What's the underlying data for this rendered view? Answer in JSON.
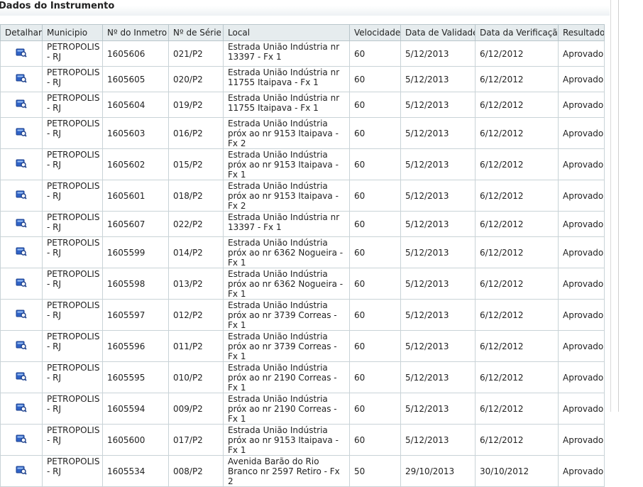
{
  "section": {
    "title": "Dados do Instrumento"
  },
  "table": {
    "headers": [
      "Detalhar",
      "Municipio",
      "Nº do Inmetro",
      "Nº de Série",
      "Local",
      "Velocidade",
      "Data de Validade",
      "Data da Verificação",
      "Resultado"
    ],
    "detail_icon": "detail-magnifier-icon",
    "rows": [
      {
        "municipio": "PETROPOLIS - RJ",
        "inmetro": "1605606",
        "serie": "021/P2",
        "local": "Estrada União Indústria nr 13397 - Fx 1",
        "velocidade": "60",
        "validade": "5/12/2013",
        "verificacao": "6/12/2012",
        "resultado": "Aprovado"
      },
      {
        "municipio": "PETROPOLIS - RJ",
        "inmetro": "1605605",
        "serie": "020/P2",
        "local": "Estrada União Indústria nr 11755 Itaipava - Fx 1",
        "velocidade": "60",
        "validade": "5/12/2013",
        "verificacao": "6/12/2012",
        "resultado": "Aprovado"
      },
      {
        "municipio": "PETROPOLIS - RJ",
        "inmetro": "1605604",
        "serie": "019/P2",
        "local": "Estrada União Indústria nr 11755 Itaipava - Fx 1",
        "velocidade": "60",
        "validade": "5/12/2013",
        "verificacao": "6/12/2012",
        "resultado": "Aprovado"
      },
      {
        "municipio": "PETROPOLIS - RJ",
        "inmetro": "1605603",
        "serie": "016/P2",
        "local": "Estrada União Indústria próx ao nr 9153 Itaipava - Fx 2",
        "velocidade": "60",
        "validade": "5/12/2013",
        "verificacao": "6/12/2012",
        "resultado": "Aprovado"
      },
      {
        "municipio": "PETROPOLIS - RJ",
        "inmetro": "1605602",
        "serie": "015/P2",
        "local": "Estrada União Indústria próx ao nr 9153 Itaipava - Fx 1",
        "velocidade": "60",
        "validade": "5/12/2013",
        "verificacao": "6/12/2012",
        "resultado": "Aprovado"
      },
      {
        "municipio": "PETROPOLIS - RJ",
        "inmetro": "1605601",
        "serie": "018/P2",
        "local": "Estrada União Indústria próx ao nr 9153 Itaipava - Fx 2",
        "velocidade": "60",
        "validade": "5/12/2013",
        "verificacao": "6/12/2012",
        "resultado": "Aprovado"
      },
      {
        "municipio": "PETROPOLIS - RJ",
        "inmetro": "1605607",
        "serie": "022/P2",
        "local": "Estrada União Indústria nr 13397 - Fx 1",
        "velocidade": "60",
        "validade": "5/12/2013",
        "verificacao": "6/12/2012",
        "resultado": "Aprovado"
      },
      {
        "municipio": "PETROPOLIS - RJ",
        "inmetro": "1605599",
        "serie": "014/P2",
        "local": "Estrada União Indústria próx ao nr 6362 Nogueira - Fx 1",
        "velocidade": "60",
        "validade": "5/12/2013",
        "verificacao": "6/12/2012",
        "resultado": "Aprovado"
      },
      {
        "municipio": "PETROPOLIS - RJ",
        "inmetro": "1605598",
        "serie": "013/P2",
        "local": "Estrada União Indústria próx ao nr 6362 Nogueira - Fx 1",
        "velocidade": "60",
        "validade": "5/12/2013",
        "verificacao": "6/12/2012",
        "resultado": "Aprovado"
      },
      {
        "municipio": "PETROPOLIS - RJ",
        "inmetro": "1605597",
        "serie": "012/P2",
        "local": "Estrada União Indústria próx ao nr 3739 Correas - Fx 1",
        "velocidade": "60",
        "validade": "5/12/2013",
        "verificacao": "6/12/2012",
        "resultado": "Aprovado"
      },
      {
        "municipio": "PETROPOLIS - RJ",
        "inmetro": "1605596",
        "serie": "011/P2",
        "local": "Estrada União Indústria próx ao nr 3739 Correas - Fx 1",
        "velocidade": "60",
        "validade": "5/12/2013",
        "verificacao": "6/12/2012",
        "resultado": "Aprovado"
      },
      {
        "municipio": "PETROPOLIS - RJ",
        "inmetro": "1605595",
        "serie": "010/P2",
        "local": "Estrada União Indústria próx ao nr 2190 Correas - Fx 1",
        "velocidade": "60",
        "validade": "5/12/2013",
        "verificacao": "6/12/2012",
        "resultado": "Aprovado"
      },
      {
        "municipio": "PETROPOLIS - RJ",
        "inmetro": "1605594",
        "serie": "009/P2",
        "local": "Estrada União Indústria próx ao nr 2190 Correas - Fx 1",
        "velocidade": "60",
        "validade": "5/12/2013",
        "verificacao": "6/12/2012",
        "resultado": "Aprovado"
      },
      {
        "municipio": "PETROPOLIS - RJ",
        "inmetro": "1605600",
        "serie": "017/P2",
        "local": "Estrada União Indústria próx ao nr 9153 Itaipava - Fx 1",
        "velocidade": "60",
        "validade": "5/12/2013",
        "verificacao": "6/12/2012",
        "resultado": "Aprovado"
      },
      {
        "municipio": "PETROPOLIS - RJ",
        "inmetro": "1605534",
        "serie": "008/P2",
        "local": "Avenida Barão do Rio Branco nr 2597 Retiro - Fx 2",
        "velocidade": "50",
        "validade": "29/10/2013",
        "verificacao": "30/10/2012",
        "resultado": "Aprovado"
      }
    ]
  }
}
